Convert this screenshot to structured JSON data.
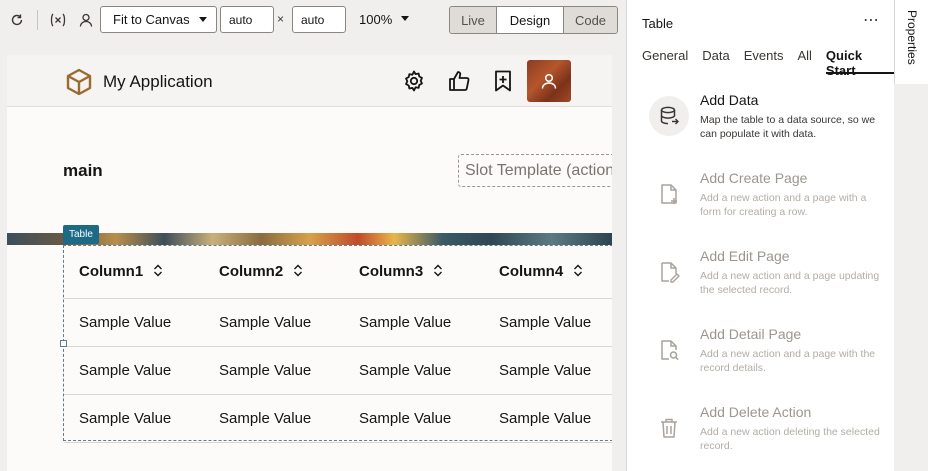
{
  "toolbar": {
    "fit_option": "Fit to Canvas",
    "width_value": "auto",
    "height_value": "auto",
    "times": "×",
    "zoom": "100%",
    "modes": [
      {
        "label": "Live",
        "active": false
      },
      {
        "label": "Design",
        "active": true
      },
      {
        "label": "Code",
        "active": false
      }
    ]
  },
  "app": {
    "title": "My Application",
    "main_label": "main",
    "slot_template": "Slot Template (action"
  },
  "table": {
    "badge": "Table",
    "columns": [
      "Column1",
      "Column2",
      "Column3",
      "Column4"
    ],
    "rows": [
      [
        "Sample Value",
        "Sample Value",
        "Sample Value",
        "Sample Value"
      ],
      [
        "Sample Value",
        "Sample Value",
        "Sample Value",
        "Sample Value"
      ],
      [
        "Sample Value",
        "Sample Value",
        "Sample Value",
        "Sample Value"
      ]
    ]
  },
  "panel": {
    "title": "Table",
    "more": "⋯",
    "tabs": [
      "General",
      "Data",
      "Events",
      "All",
      "Quick Start"
    ],
    "active_tab": "Quick Start",
    "quick_start": [
      {
        "title": "Add Data",
        "desc": "Map the table to a data source, so we can populate it with data.",
        "icon": "database-icon",
        "enabled": true
      },
      {
        "title": "Add Create Page",
        "desc": "Add a new action and a page with a form for creating a row.",
        "icon": "file-add-icon",
        "enabled": false
      },
      {
        "title": "Add Edit Page",
        "desc": "Add a new action and a page updating the selected record.",
        "icon": "file-edit-icon",
        "enabled": false
      },
      {
        "title": "Add Detail Page",
        "desc": "Add a new action and a page with the record details.",
        "icon": "file-search-icon",
        "enabled": false
      },
      {
        "title": "Add Delete Action",
        "desc": "Add a new action deleting the selected record.",
        "icon": "trash-icon",
        "enabled": false
      }
    ]
  },
  "rail": {
    "label": "Properties"
  },
  "colors": {
    "accent": "#1c6a85",
    "avatar": "#a04a25",
    "logo": "#9a6a2f"
  }
}
